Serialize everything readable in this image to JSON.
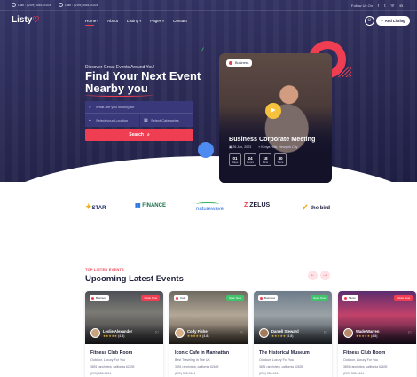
{
  "colors": {
    "accent": "#ef3e52",
    "hero_bg": "#27264f",
    "play": "#f6c23e",
    "open": "#3fc36b",
    "close": "#ef3e52"
  },
  "topbar": {
    "phone1": "Call : (209) 555-0104",
    "phone2": "Call : (209) 555-0104",
    "follow_label": "Follow Us On",
    "socials": [
      "f",
      "t",
      "◎",
      "in"
    ]
  },
  "header": {
    "logo_text": "Listy",
    "nav": [
      {
        "label": "Home",
        "has_dropdown": true
      },
      {
        "label": "About",
        "has_dropdown": false
      },
      {
        "label": "Listing",
        "has_dropdown": true
      },
      {
        "label": "Pages",
        "has_dropdown": true
      },
      {
        "label": "Contact",
        "has_dropdown": false
      }
    ],
    "add_listing_label": "Add Listing"
  },
  "hero": {
    "eyebrow": "Discover Great Events Around You!",
    "headline_line1": "Find Your Next Event",
    "headline_line2": "Nearby you",
    "search_placeholder": "What are you looking for",
    "location_placeholder": "Select your Location",
    "category_placeholder": "Select Categories",
    "search_button": "Search"
  },
  "event_card": {
    "badge": "Business",
    "title": "Business Corporate Meeting",
    "date": "26 Jan, 2023",
    "location": "Kenya Hills, Newyork City",
    "countdown": [
      {
        "value": "01",
        "label": "Days"
      },
      {
        "value": "24",
        "label": "Hours"
      },
      {
        "value": "18",
        "label": "Mins"
      },
      {
        "value": "30",
        "label": "Secs"
      }
    ]
  },
  "brands": [
    {
      "name": "STAR",
      "sub": ""
    },
    {
      "name": "FINANCE",
      "sub": ""
    },
    {
      "name": "naturewave",
      "sub": ""
    },
    {
      "name": "ZELUS",
      "sub": ""
    },
    {
      "name": "the bird",
      "sub": ""
    }
  ],
  "section": {
    "eyebrow": "TOP LISTED EVENTS",
    "title": "Upcoming Latest Events"
  },
  "listings": [
    {
      "category": "Business",
      "status": "Close Now",
      "status_color": "#ef3e52",
      "owner": "Leslie Alexander",
      "reviews": "(4.8)",
      "title": "Fitness Club Room",
      "subtitle": "Outdoor, Luxury For You",
      "address": "3891 ranchview, california 62639",
      "phone": "(209) 555-0104"
    },
    {
      "category": "Cafe",
      "status": "Open Now",
      "status_color": "#3fc36b",
      "owner": "Cody Fisher",
      "reviews": "(4.8)",
      "title": "Iconic Cafe In Manhattan",
      "subtitle": "Best Traveling In The UK",
      "address": "3891 ranchview, california 62639",
      "phone": "(209) 555-0104"
    },
    {
      "category": "Business",
      "status": "Open Now",
      "status_color": "#3fc36b",
      "owner": "Darrell Steward",
      "reviews": "(4.8)",
      "title": "The Historical Museum",
      "subtitle": "Outdoor, Luxury For You",
      "address": "3891 ranchview, california 62639",
      "phone": "(209) 555-0104"
    },
    {
      "category": "Music",
      "status": "Close Now",
      "status_color": "#ef3e52",
      "owner": "Wade Warren",
      "reviews": "(4.8)",
      "title": "Fitness Club Room",
      "subtitle": "Outdoor, Luxury For You",
      "address": "3891 ranchview, california 62639",
      "phone": "(209) 555-0104"
    }
  ]
}
